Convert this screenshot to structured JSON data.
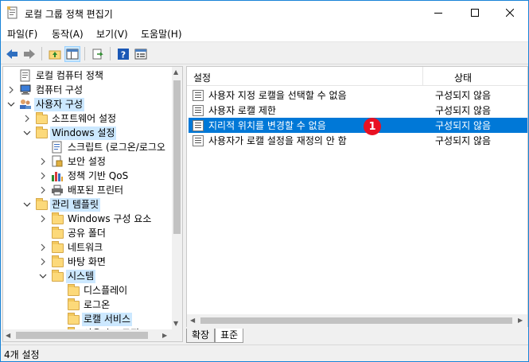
{
  "window": {
    "title": "로컬 그룹 정책 편집기",
    "border_color": "#1883d7"
  },
  "menu": [
    {
      "label": "파일(F)"
    },
    {
      "label": "동작(A)"
    },
    {
      "label": "보기(V)"
    },
    {
      "label": "도움말(H)"
    }
  ],
  "toolbar": {
    "icons": [
      "back-icon",
      "forward-icon",
      "up-folder-icon",
      "show-hide-tree-icon",
      "export-list-icon",
      "help-icon",
      "properties-icon"
    ]
  },
  "tree": {
    "items": [
      {
        "label": "로컬 컴퓨터 정책",
        "icon": "policy-icon",
        "expander": "none",
        "selected": false
      },
      {
        "label": "컴퓨터 구성",
        "icon": "computer-icon",
        "expander": "collapsed",
        "selected": false
      },
      {
        "label": "사용자 구성",
        "icon": "users-icon",
        "expander": "expanded",
        "selected": true
      },
      {
        "label": "소프트웨어 설정",
        "icon": "folder-icon",
        "expander": "collapsed",
        "selected": false
      },
      {
        "label": "Windows 설정",
        "icon": "folder-icon",
        "expander": "expanded",
        "selected": true
      },
      {
        "label": "스크립트 (로그온/로그오",
        "icon": "script-icon",
        "expander": "none",
        "selected": false
      },
      {
        "label": "보안 설정",
        "icon": "security-icon",
        "expander": "collapsed",
        "selected": false
      },
      {
        "label": "정책 기반 QoS",
        "icon": "chart-icon",
        "expander": "collapsed",
        "selected": false
      },
      {
        "label": "배포된 프린터",
        "icon": "printer-icon",
        "expander": "collapsed",
        "selected": false
      },
      {
        "label": "관리 템플릿",
        "icon": "folder-icon",
        "expander": "expanded",
        "selected": true
      },
      {
        "label": "Windows 구성 요소",
        "icon": "folder-icon",
        "expander": "collapsed",
        "selected": false
      },
      {
        "label": "공유 폴더",
        "icon": "folder-icon",
        "expander": "none",
        "selected": false
      },
      {
        "label": "네트워크",
        "icon": "folder-icon",
        "expander": "collapsed",
        "selected": false
      },
      {
        "label": "바탕 화면",
        "icon": "folder-icon",
        "expander": "collapsed",
        "selected": false
      },
      {
        "label": "시스템",
        "icon": "folder-icon",
        "expander": "expanded",
        "selected": true
      },
      {
        "label": "디스플레이",
        "icon": "folder-icon",
        "expander": "none",
        "selected": false
      },
      {
        "label": "로그온",
        "icon": "folder-icon",
        "expander": "none",
        "selected": false
      },
      {
        "label": "로캘 서비스",
        "icon": "folder-icon",
        "expander": "none",
        "selected": true
      },
      {
        "label": "사용자 프로필",
        "icon": "folder-icon",
        "expander": "none",
        "selected": false
      }
    ]
  },
  "list": {
    "columns": [
      "설정",
      "상태"
    ],
    "rows": [
      {
        "name": "사용자 지정 로캘을 선택할 수 없음",
        "state": "구성되지 않음",
        "selected": false
      },
      {
        "name": "사용자 로캘 제한",
        "state": "구성되지 않음",
        "selected": false
      },
      {
        "name": "지리적 위치를 변경할 수 없음",
        "state": "구성되지 않음",
        "selected": true
      },
      {
        "name": "사용자가 로캘 설정을 재정의 안 함",
        "state": "구성되지 않음",
        "selected": false
      }
    ],
    "selection_color": "#0078d7"
  },
  "callout": {
    "label": "1",
    "color": "#e81123"
  },
  "tabs": [
    {
      "label": "확장",
      "active": false
    },
    {
      "label": "표준",
      "active": true
    }
  ],
  "status": {
    "text": "4개 설정"
  }
}
